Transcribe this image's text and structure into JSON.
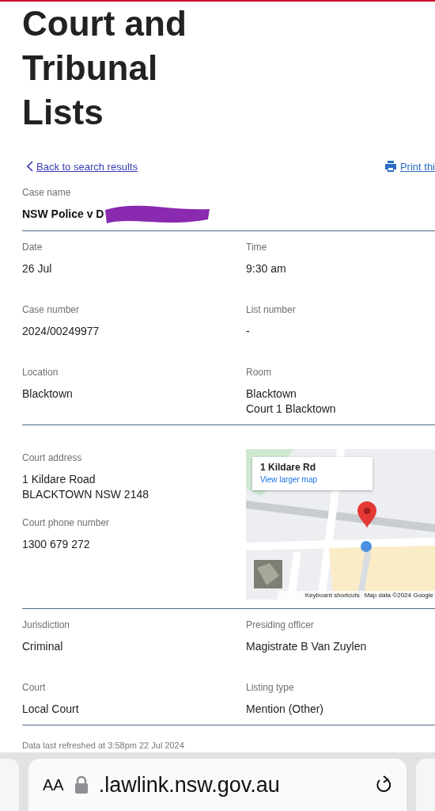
{
  "title": "Court and Tribunal Lists",
  "back_link": "Back to search results",
  "print_link": "Print thi",
  "case_name": {
    "label": "Case name",
    "value": "NSW Police v D",
    "redacted": true
  },
  "sections": [
    {
      "kind": "grid",
      "items": [
        {
          "label": "Date",
          "lines": [
            "26 Jul"
          ]
        },
        {
          "label": "Time",
          "lines": [
            "9:30 am"
          ]
        },
        {
          "label": "Case number",
          "lines": [
            "2024/00249977"
          ]
        },
        {
          "label": "List number",
          "lines": [
            "-"
          ]
        },
        {
          "label": "Location",
          "lines": [
            "Blacktown"
          ]
        },
        {
          "label": "Room",
          "lines": [
            "Blacktown",
            "Court 1 Blacktown"
          ]
        }
      ]
    },
    {
      "kind": "address",
      "items": [
        {
          "label": "Court address",
          "lines": [
            "1 Kildare Road",
            "BLACKTOWN NSW 2148"
          ]
        },
        {
          "label": "Court phone number",
          "lines": [
            "1300 679 272"
          ]
        }
      ],
      "map": {
        "kind": "picture",
        "place": "1 Kildare Rd",
        "link": "View larger map",
        "footer": [
          "Keyboard shortcuts",
          "Map data ©2024 Google"
        ]
      }
    },
    {
      "kind": "grid",
      "items": [
        {
          "label": "Jurisdiction",
          "lines": [
            "Criminal"
          ]
        },
        {
          "label": "Presiding officer",
          "lines": [
            "Magistrate B Van Zuylen"
          ]
        },
        {
          "label": "Court",
          "lines": [
            "Local Court"
          ]
        },
        {
          "label": "Listing type",
          "lines": [
            "Mention (Other)"
          ]
        }
      ]
    }
  ],
  "refreshed": "Data last refreshed at 3:58pm 22 Jul 2024",
  "browser": {
    "text_size": "AA",
    "url": ".lawlink.nsw.gov.au"
  }
}
